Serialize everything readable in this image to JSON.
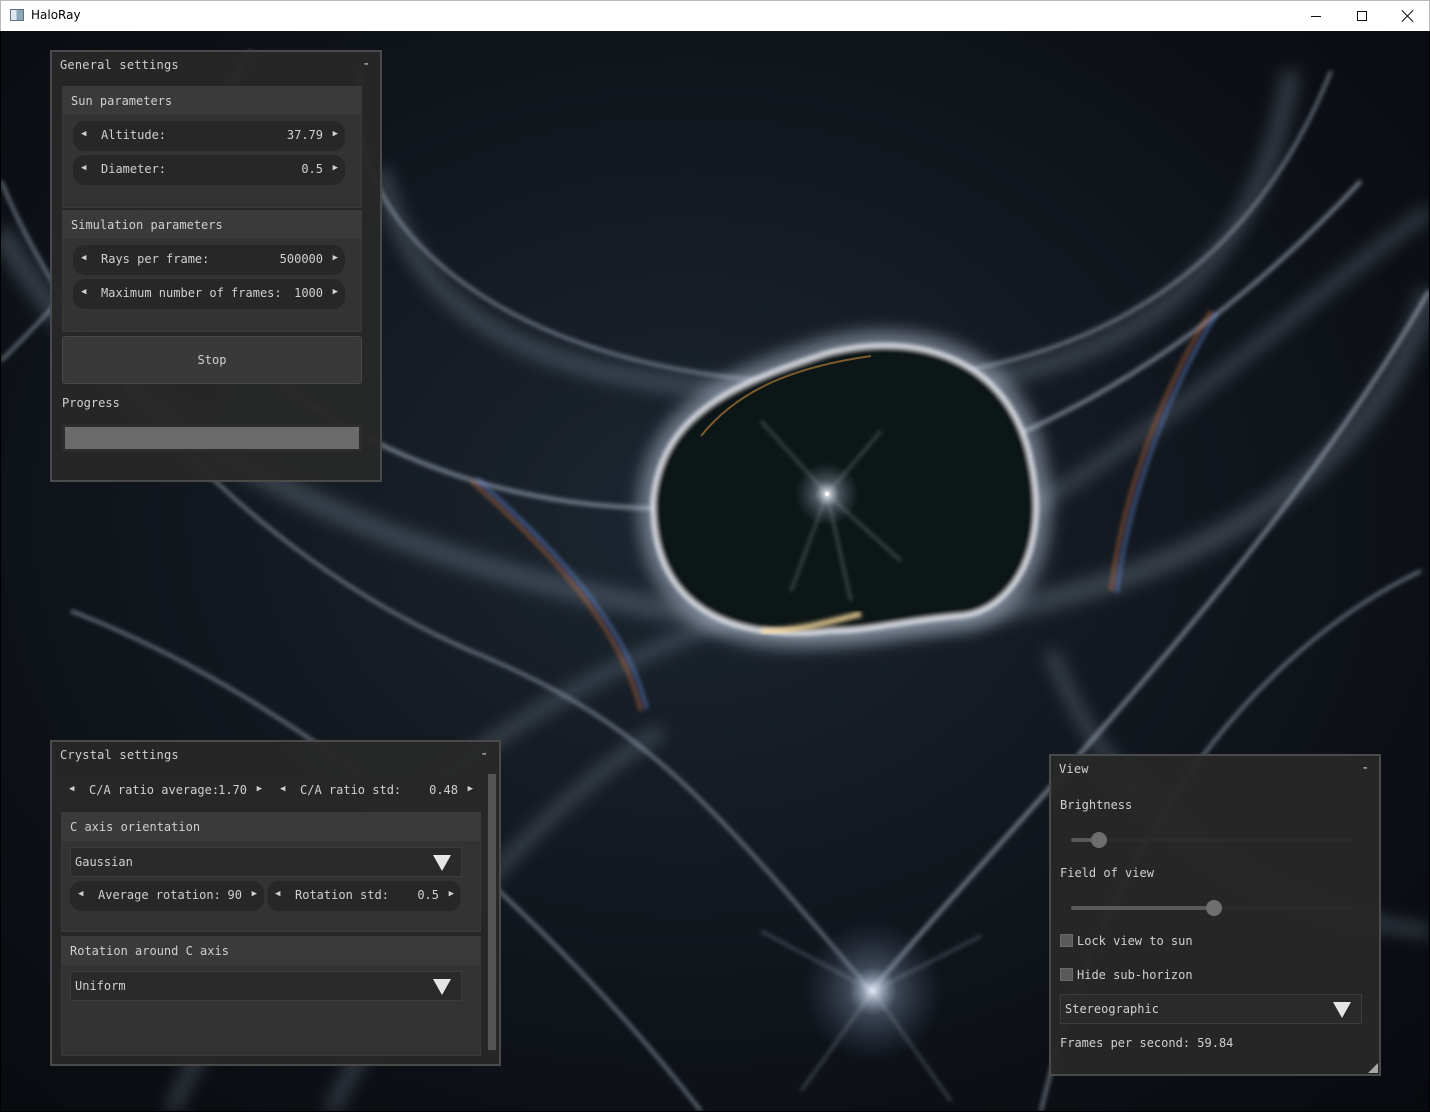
{
  "window": {
    "title": "HaloRay",
    "icon": "app-window-icon",
    "controls": [
      "minimize-icon",
      "maximize-icon",
      "close-icon"
    ]
  },
  "colors": {
    "panel_bg": "#282828",
    "group_header_bg": "#3a3a3a",
    "drag_bg": "#272727",
    "text": "#d0d0d0",
    "sky": "#141a22",
    "halo": "#b8c4d6"
  },
  "general": {
    "title": "General settings",
    "collapse": "-",
    "sun": {
      "header": "Sun parameters",
      "altitude_label": "Altitude:",
      "altitude_value": "37.79",
      "diameter_label": "Diameter:",
      "diameter_value": "0.5"
    },
    "sim": {
      "header": "Simulation parameters",
      "rays_label": "Rays per frame:",
      "rays_value": "500000",
      "frames_label": "Maximum number of frames:",
      "frames_value": "1000"
    },
    "stop_label": "Stop",
    "progress_label": "Progress",
    "progress_fraction": 1.0
  },
  "crystal": {
    "title": "Crystal settings",
    "collapse": "-",
    "ca_avg_label": "C/A ratio average:",
    "ca_avg_value": "1.70",
    "ca_std_label": "C/A ratio std:",
    "ca_std_value": "0.48",
    "c_axis": {
      "header": "C axis orientation",
      "selected": "Gaussian",
      "avg_rot_label": "Average rotation:",
      "avg_rot_value": "90",
      "rot_std_label": "Rotation std:",
      "rot_std_value": "0.5"
    },
    "rotation": {
      "header": "Rotation around C axis",
      "selected": "Uniform"
    }
  },
  "view": {
    "title": "View",
    "collapse": "-",
    "brightness_label": "Brightness",
    "brightness_level": 0.1,
    "fov_label": "Field of view",
    "fov_level": 0.51,
    "lock_label": "Lock view to sun",
    "lock_checked": false,
    "hide_label": "Hide sub-horizon",
    "hide_checked": false,
    "projection": "Stereographic",
    "fps_label": "Frames per second: 59.84"
  }
}
